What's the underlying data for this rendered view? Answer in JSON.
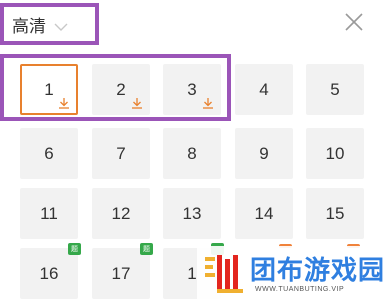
{
  "header": {
    "quality_label": "高清",
    "chevron_icon": "chevron-down-icon",
    "close_icon": "close-icon"
  },
  "episodes": [
    {
      "number": "1",
      "downloaded": true,
      "selected": true
    },
    {
      "number": "2",
      "downloaded": true
    },
    {
      "number": "3",
      "downloaded": true
    },
    {
      "number": "4"
    },
    {
      "number": "5"
    },
    {
      "number": "6"
    },
    {
      "number": "7"
    },
    {
      "number": "8"
    },
    {
      "number": "9"
    },
    {
      "number": "10"
    },
    {
      "number": "11"
    },
    {
      "number": "12"
    },
    {
      "number": "13"
    },
    {
      "number": "14"
    },
    {
      "number": "15"
    },
    {
      "number": "16",
      "badge": "green",
      "badge_text": "题"
    },
    {
      "number": "17",
      "badge": "green",
      "badge_text": "题"
    },
    {
      "number": "1",
      "badge": "green",
      "badge_text": ""
    }
  ],
  "watermark": {
    "text": "团布游戏园",
    "url": "WWW.TUANBUTING.VIP"
  },
  "colors": {
    "selected_border": "#e8812e",
    "download_icon": "#e8812e",
    "badge_green": "#35a84a",
    "badge_orange": "#f0823a",
    "annotation": "#9b55b8",
    "watermark_blue": "#2f7fe0"
  }
}
